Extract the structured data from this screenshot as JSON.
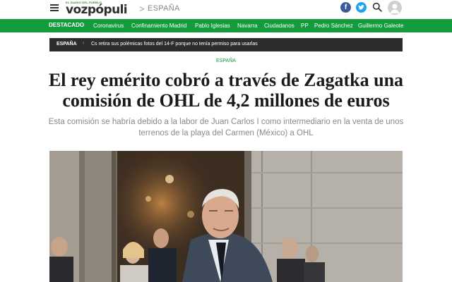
{
  "header": {
    "logo_tagline": "EL DIARIO DEL PUEBLO",
    "logo_text": "vozpópuli",
    "breadcrumb_separator": ">",
    "section": "ESPAÑA",
    "facebook_glyph": "f",
    "icons": [
      "menu-icon",
      "facebook-icon",
      "twitter-icon",
      "search-icon",
      "user-avatar-icon"
    ]
  },
  "nav": {
    "featured_label": "DESTACADO",
    "items": [
      "Coronavirus",
      "Confinamiento Madrid",
      "Pablo Iglesias",
      "Navarra",
      "Ciudadanos",
      "PP",
      "Pedro Sánchez",
      "Guillermo Galeote"
    ]
  },
  "breaking": {
    "tag": "ESPAÑA",
    "arrow": "›",
    "text": "Cs retira sus polémicas fotos del 14-F porque no tenía permiso para usarlas"
  },
  "article": {
    "kicker": "ESPAÑA",
    "title": "El rey emérito cobró a través de Zagatka una comisión de OHL de 4,2 millones de euros",
    "subtitle": "Esta comisión se habría debido a la labor de Juan Carlos I como intermediario en la venta de unos terrenos de la playa del Carmen (México) a OHL"
  },
  "colors": {
    "brand_green": "#139b3c",
    "strip_dark": "#2d2d2d",
    "facebook": "#3b5b98",
    "twitter": "#1da1f2"
  }
}
